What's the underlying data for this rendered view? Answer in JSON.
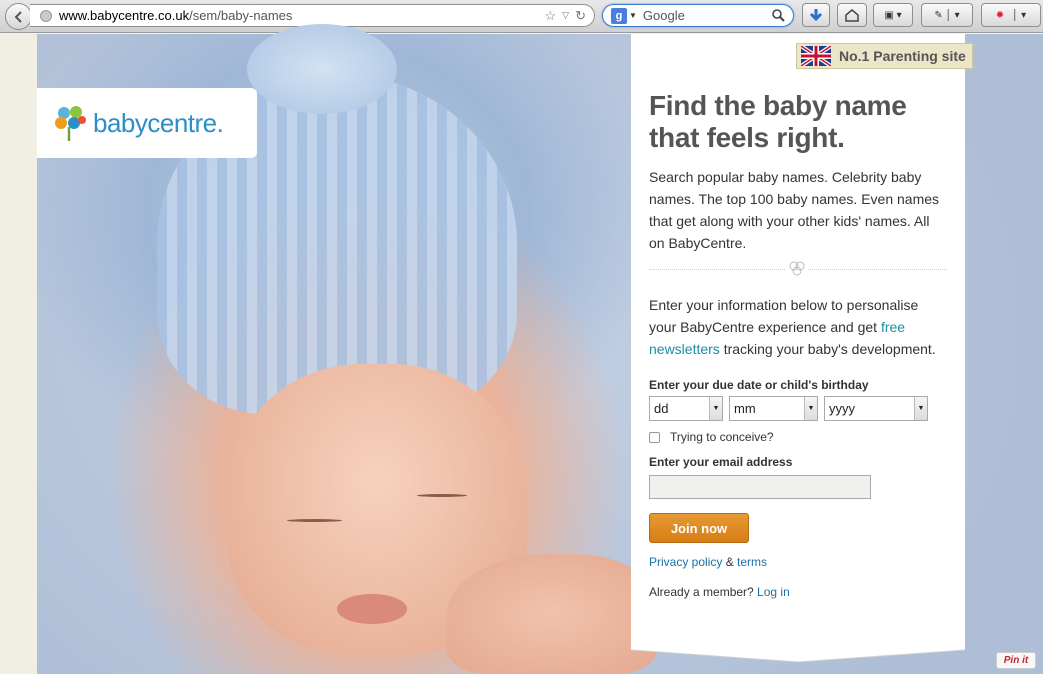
{
  "browser": {
    "url_host": "www.babycentre.co.uk",
    "url_path": "/sem/baby-names",
    "search_engine_letter": "g",
    "search_placeholder": "Google"
  },
  "logo": {
    "text": "babycentre."
  },
  "badge": {
    "text": "No.1 Parenting site"
  },
  "panel": {
    "headline": "Find the baby name that feels right.",
    "intro": "Search popular baby names. Celebrity baby names. The top 100 baby names. Even names that get along with your other kids' names. All on BabyCentre.",
    "info_before": "Enter your information below to personalise your BabyCentre experience and get ",
    "info_link": "free newsletters",
    "info_after": " tracking your baby's development.",
    "due_date_label": "Enter your due date or child's birthday",
    "day_select": "dd",
    "month_select": "mm",
    "year_select": "yyyy",
    "conceive_label": "Trying to conceive?",
    "email_label": "Enter your email address",
    "email_value": "",
    "join_button": "Join now",
    "privacy_link": "Privacy policy",
    "amp": " & ",
    "terms_link": "terms",
    "member_text": "Already a member? ",
    "login_link": "Log in"
  },
  "pinit": {
    "label": "Pin it"
  },
  "colors": {
    "brand_blue": "#2c8fc7",
    "button_orange": "#e08a24",
    "link_teal": "#1b8fa8",
    "badge_bg": "#ece6c8"
  }
}
